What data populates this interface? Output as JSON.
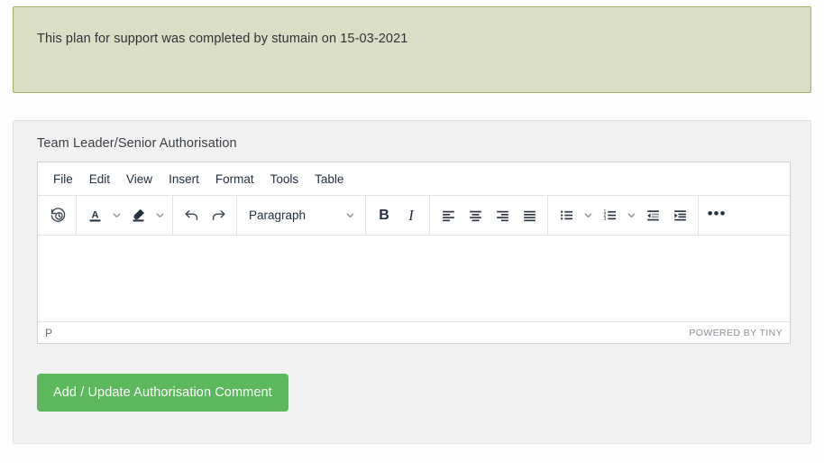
{
  "alert": {
    "message": "This plan for support was completed by stumain on 15-03-2021",
    "background_color": "#dadec4",
    "border_color": "#a6ae62",
    "text_color": "#2f3337"
  },
  "card": {
    "title": "Team Leader/Senior Authorisation",
    "background_color": "#f1f1f1"
  },
  "editor": {
    "menubar": [
      {
        "label": "File"
      },
      {
        "label": "Edit"
      },
      {
        "label": "View"
      },
      {
        "label": "Insert"
      },
      {
        "label": "Format"
      },
      {
        "label": "Tools"
      },
      {
        "label": "Table"
      }
    ],
    "toolbar": {
      "restore_draft": "restore-draft-icon",
      "text_color": "text-color-icon",
      "text_color_chevron": "chevron-down-icon",
      "highlight_color": "highlight-color-icon",
      "highlight_color_chevron": "chevron-down-icon",
      "undo": "undo-icon",
      "redo": "redo-icon",
      "block_format_value": "Paragraph",
      "block_format_chevron": "chevron-down-icon",
      "bold": "B",
      "italic": "I",
      "align_left": "align-left-icon",
      "align_center": "align-center-icon",
      "align_right": "align-right-icon",
      "align_justify": "align-justify-icon",
      "bullet_list": "bullet-list-icon",
      "bullet_list_chevron": "chevron-down-icon",
      "numbered_list": "numbered-list-icon",
      "numbered_list_chevron": "chevron-down-icon",
      "outdent": "outdent-icon",
      "indent": "indent-icon",
      "more": "•••"
    },
    "content": "",
    "statusbar": {
      "element_path": "P",
      "branding": "POWERED BY TINY"
    }
  },
  "actions": {
    "submit_label": "Add / Update Authorisation Comment",
    "submit_color": "#5cb85c"
  }
}
